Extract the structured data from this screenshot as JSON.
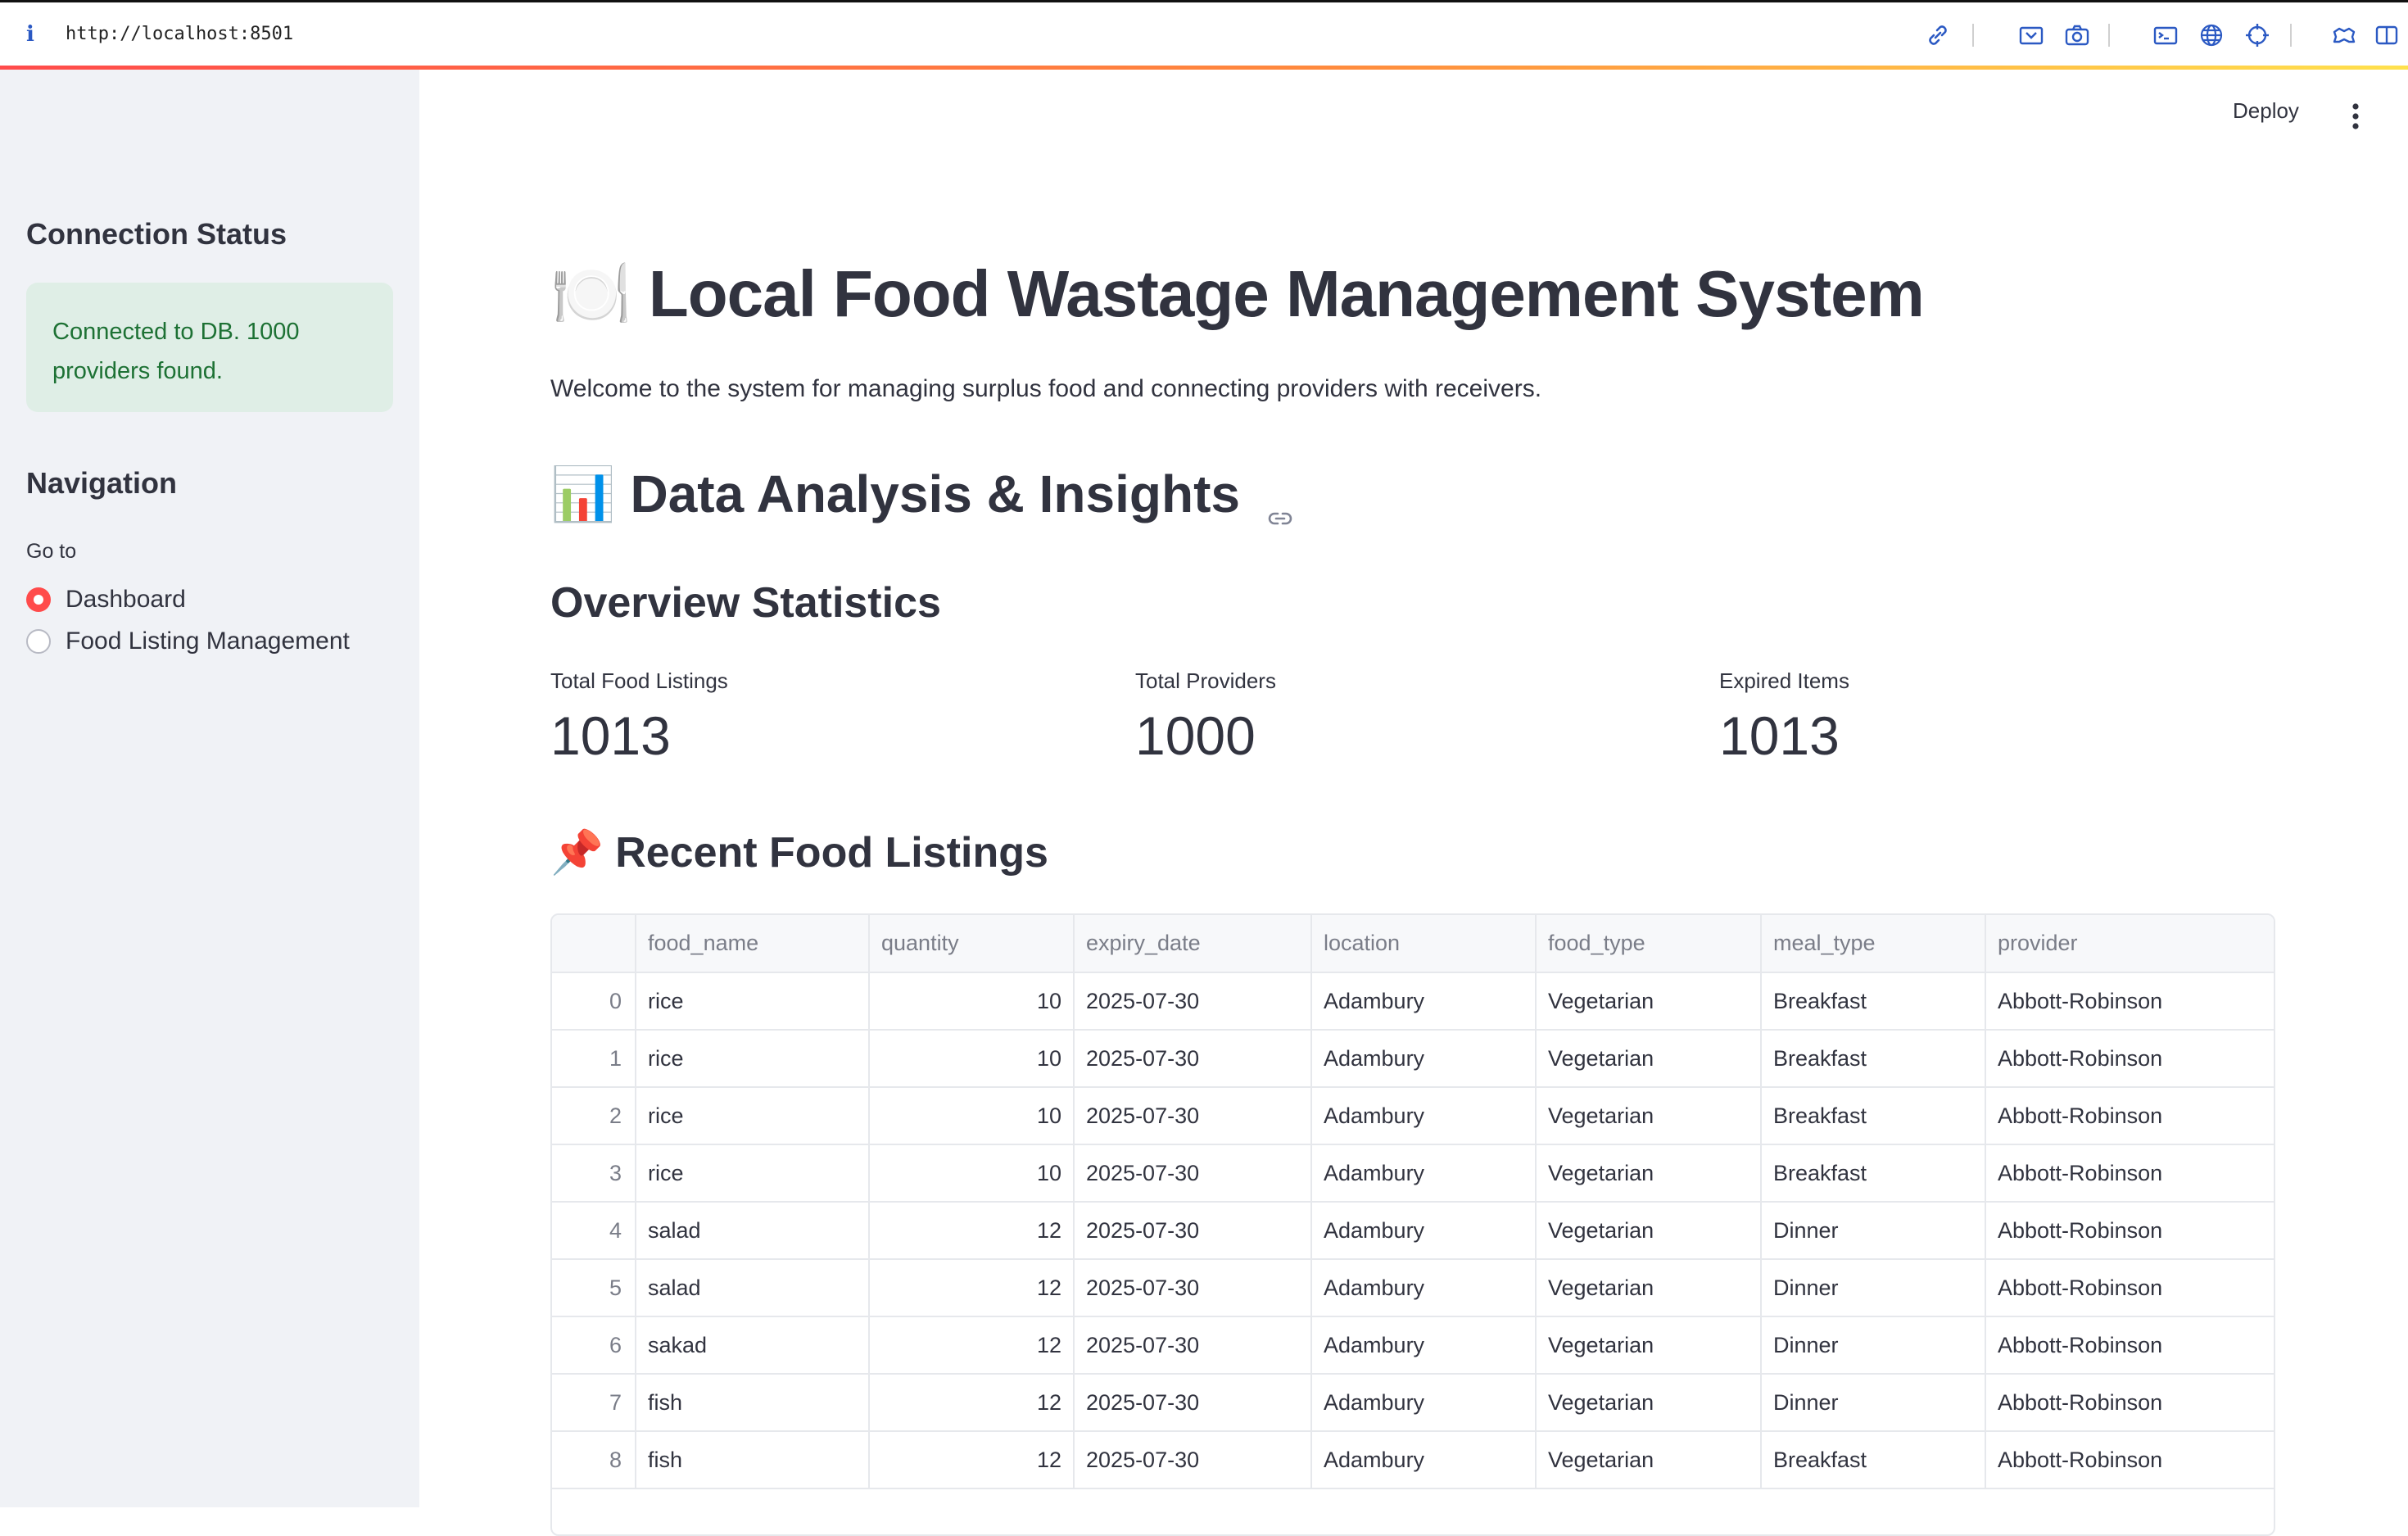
{
  "browser": {
    "info_glyph": "i",
    "url": "http://localhost:8501"
  },
  "toolbar_icons": [
    "link-icon",
    "screenshot-icon",
    "camera-icon",
    "terminal-icon",
    "globe-icon",
    "crosshair-icon",
    "extensions-icon",
    "sidebar-toggle-icon"
  ],
  "sidebar": {
    "connection_title": "Connection Status",
    "connection_message": "Connected to DB. 1000 providers found.",
    "navigation_title": "Navigation",
    "goto_label": "Go to",
    "options": [
      {
        "label": "Dashboard",
        "selected": true
      },
      {
        "label": "Food Listing Management",
        "selected": false
      }
    ]
  },
  "header": {
    "deploy_label": "Deploy"
  },
  "main": {
    "title_emoji": "🍽️",
    "title": "Local Food Wastage Management System",
    "welcome": "Welcome to the system for managing surplus food and connecting providers with receivers.",
    "analysis_emoji": "📊",
    "analysis_title": "Data Analysis & Insights",
    "overview_title": "Overview Statistics",
    "metrics": [
      {
        "label": "Total Food Listings",
        "value": "1013"
      },
      {
        "label": "Total Providers",
        "value": "1000"
      },
      {
        "label": "Expired Items",
        "value": "1013"
      }
    ],
    "recent_emoji": "📌",
    "recent_title": "Recent Food Listings"
  },
  "table": {
    "columns": [
      "",
      "food_name",
      "quantity",
      "expiry_date",
      "location",
      "food_type",
      "meal_type",
      "provider"
    ],
    "rows": [
      [
        "0",
        "rice",
        "10",
        "2025-07-30",
        "Adambury",
        "Vegetarian",
        "Breakfast",
        "Abbott-Robinson"
      ],
      [
        "1",
        "rice",
        "10",
        "2025-07-30",
        "Adambury",
        "Vegetarian",
        "Breakfast",
        "Abbott-Robinson"
      ],
      [
        "2",
        "rice",
        "10",
        "2025-07-30",
        "Adambury",
        "Vegetarian",
        "Breakfast",
        "Abbott-Robinson"
      ],
      [
        "3",
        "rice",
        "10",
        "2025-07-30",
        "Adambury",
        "Vegetarian",
        "Breakfast",
        "Abbott-Robinson"
      ],
      [
        "4",
        "salad",
        "12",
        "2025-07-30",
        "Adambury",
        "Vegetarian",
        "Dinner",
        "Abbott-Robinson"
      ],
      [
        "5",
        "salad",
        "12",
        "2025-07-30",
        "Adambury",
        "Vegetarian",
        "Dinner",
        "Abbott-Robinson"
      ],
      [
        "6",
        "sakad",
        "12",
        "2025-07-30",
        "Adambury",
        "Vegetarian",
        "Dinner",
        "Abbott-Robinson"
      ],
      [
        "7",
        "fish",
        "12",
        "2025-07-30",
        "Adambury",
        "Vegetarian",
        "Dinner",
        "Abbott-Robinson"
      ],
      [
        "8",
        "fish",
        "12",
        "2025-07-30",
        "Adambury",
        "Vegetarian",
        "Breakfast",
        "Abbott-Robinson"
      ]
    ]
  },
  "colors": {
    "accent": "#ff4b4b",
    "sidebar_bg": "#f0f2f6",
    "success_bg": "#dfeee6",
    "success_text": "#1d7134",
    "text": "#31333f"
  }
}
